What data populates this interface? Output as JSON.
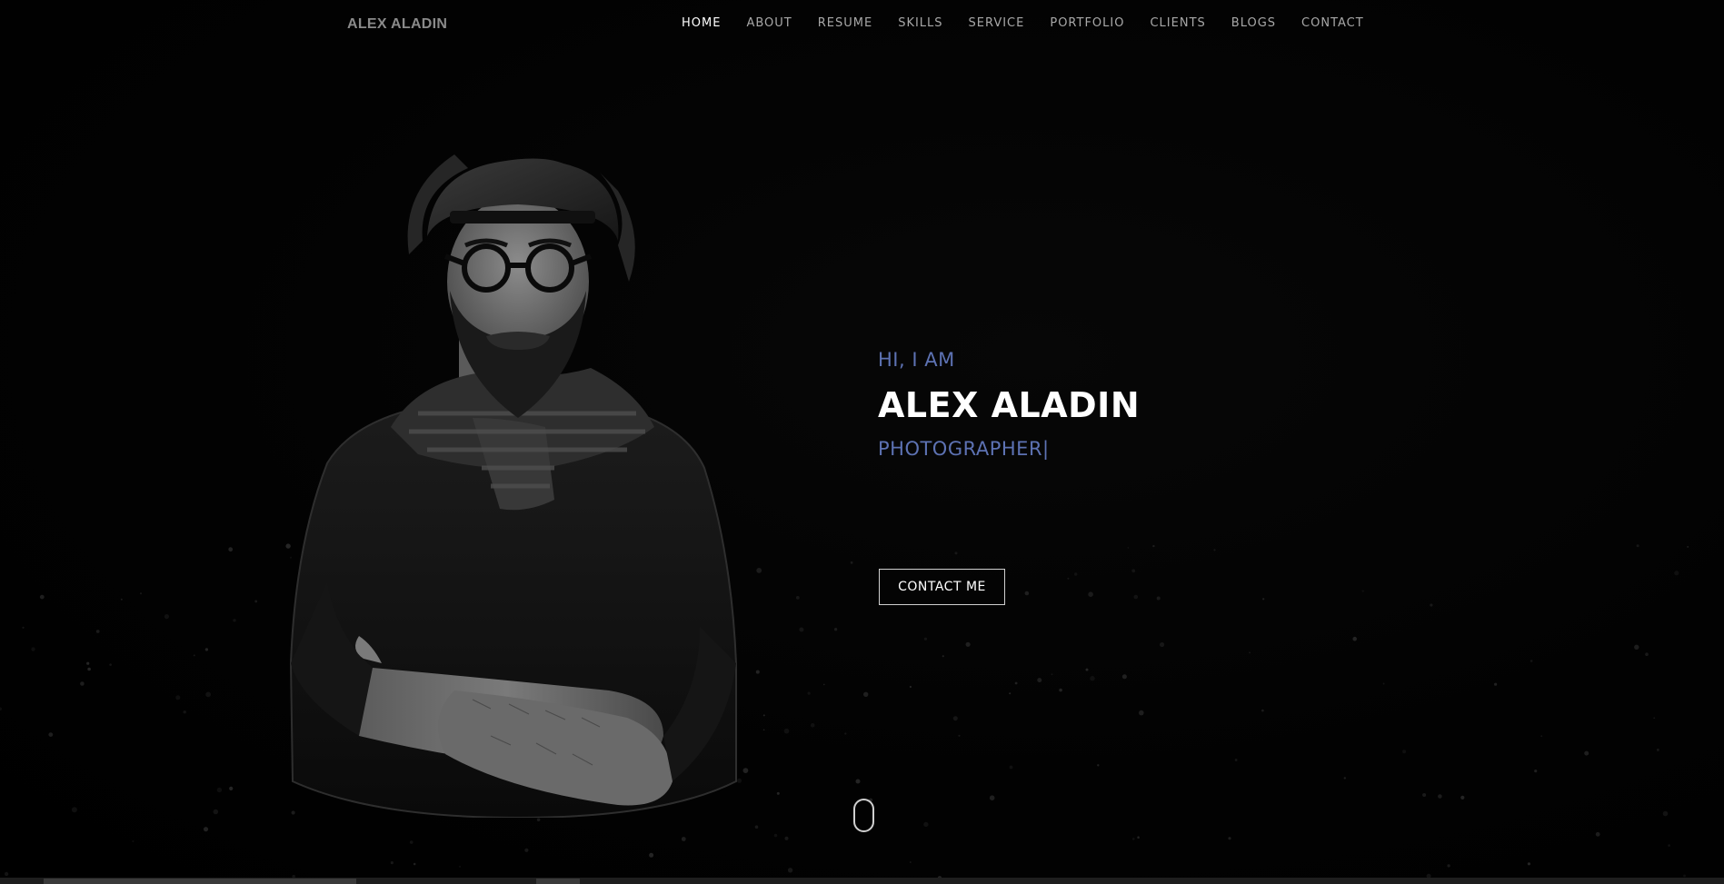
{
  "header": {
    "brand": "ALEX ALADIN",
    "nav": [
      {
        "label": "HOME",
        "active": true
      },
      {
        "label": "ABOUT",
        "active": false
      },
      {
        "label": "RESUME",
        "active": false
      },
      {
        "label": "SKILLS",
        "active": false
      },
      {
        "label": "SERVICE",
        "active": false
      },
      {
        "label": "PORTFOLIO",
        "active": false
      },
      {
        "label": "CLIENTS",
        "active": false
      },
      {
        "label": "BLOGS",
        "active": false
      },
      {
        "label": "CONTACT",
        "active": false
      }
    ]
  },
  "hero": {
    "greeting": "HI, I AM",
    "name": "ALEX ALADIN",
    "role": "PHOTOGRAPHER|",
    "cta_label": "CONTACT ME"
  },
  "colors": {
    "background": "#020202",
    "accent": "#5d72b3",
    "nav_text": "#a8a8a8",
    "nav_active": "#ffffff"
  },
  "icons": {
    "scroll": "mouse-scroll-icon"
  }
}
